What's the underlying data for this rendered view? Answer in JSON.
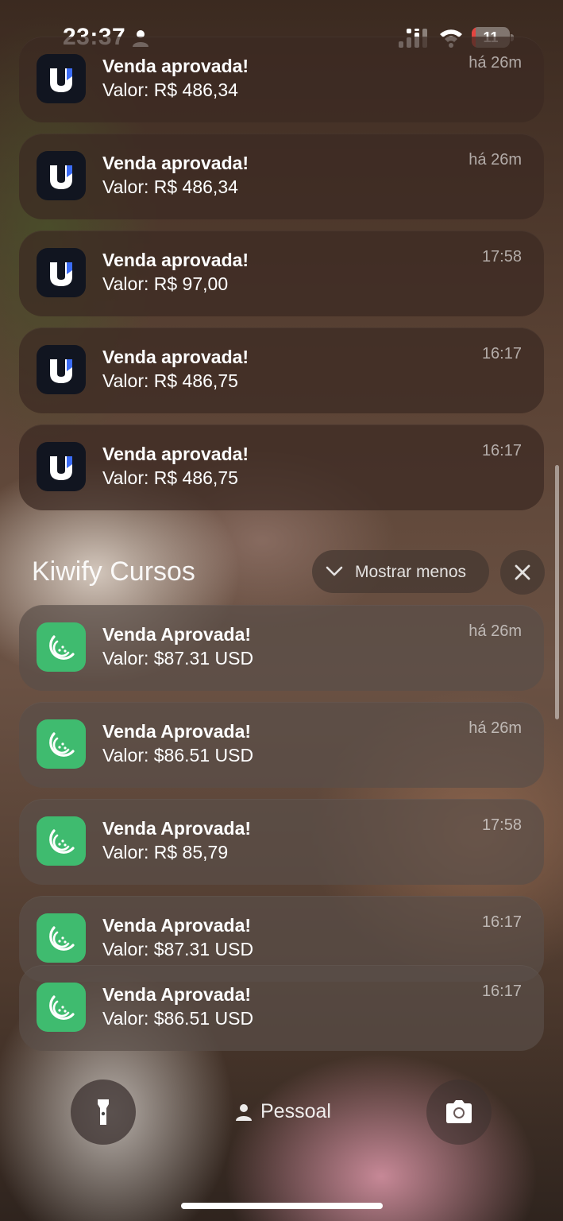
{
  "status_bar": {
    "time": "23:37",
    "battery": "11",
    "battery_color": "#e5443f"
  },
  "icons": {
    "app_u": "u-app-icon",
    "app_kiwi": "kiwify-icon",
    "flashlight": "flashlight-icon",
    "camera": "camera-icon",
    "person": "person-icon"
  },
  "u_notifications": [
    {
      "title": "Venda aprovada!",
      "body": "Valor: R$ 486,34",
      "time": "há 26m"
    },
    {
      "title": "Venda aprovada!",
      "body": "Valor: R$ 486,34",
      "time": "há 26m"
    },
    {
      "title": "Venda aprovada!",
      "body": "Valor: R$ 97,00",
      "time": "17:58"
    },
    {
      "title": "Venda aprovada!",
      "body": "Valor: R$ 486,75",
      "time": "16:17"
    },
    {
      "title": "Venda aprovada!",
      "body": "Valor: R$ 486,75",
      "time": "16:17"
    }
  ],
  "kiwify_group": {
    "title": "Kiwify Cursos",
    "show_less_label": "Mostrar menos",
    "notifications": [
      {
        "title": "Venda Aprovada!",
        "body": "Valor: $87.31 USD",
        "time": "há 26m"
      },
      {
        "title": "Venda Aprovada!",
        "body": "Valor: $86.51 USD",
        "time": "há 26m"
      },
      {
        "title": "Venda Aprovada!",
        "body": "Valor: R$ 85,79",
        "time": "17:58"
      },
      {
        "title": "Venda Aprovada!",
        "body": "Valor: $87.31 USD",
        "time": "16:17"
      },
      {
        "title": "Venda Aprovada!",
        "body": "Valor: $86.51 USD",
        "time": "16:17"
      }
    ]
  },
  "bottom": {
    "focus_label": "Pessoal"
  },
  "colors": {
    "kiwify_green": "#3fbb6f",
    "u_icon_bg": "#111520",
    "u_icon_accent": "#3b6cf6"
  }
}
